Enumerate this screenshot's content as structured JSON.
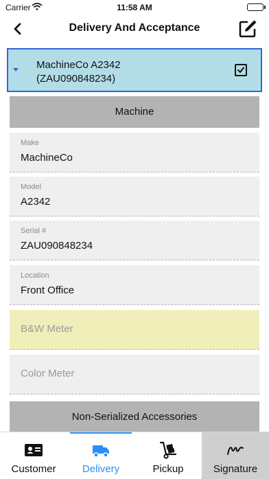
{
  "status": {
    "carrier": "Carrier",
    "time": "11:58 AM"
  },
  "nav": {
    "title": "Delivery And Acceptance",
    "back_icon": "chevron-left-icon",
    "edit_icon": "edit-icon"
  },
  "machine": {
    "title": "MachineCo A2342",
    "subtitle": "(ZAU090848234)",
    "checked": true
  },
  "sections": {
    "machine": "Machine",
    "accessories": "Non-Serialized Accessories"
  },
  "fields": {
    "make": {
      "label": "Make",
      "value": "MachineCo"
    },
    "model": {
      "label": "Model",
      "value": "A2342"
    },
    "serial": {
      "label": "Serial #",
      "value": "ZAU090848234"
    },
    "location": {
      "label": "Location",
      "value": "Front Office"
    },
    "bw_meter": {
      "placeholder": "B&W Meter"
    },
    "color_meter": {
      "placeholder": "Color Meter"
    }
  },
  "colors": {
    "accent": "#2b8ff4",
    "header_bg": "#b2dde6",
    "header_border": "#2e67d9",
    "highlight": "#f1efb9"
  },
  "tabs": [
    {
      "label": "Customer",
      "icon": "id-card-icon"
    },
    {
      "label": "Delivery",
      "icon": "delivery-truck-icon"
    },
    {
      "label": "Pickup",
      "icon": "hand-truck-icon"
    },
    {
      "label": "Signature",
      "icon": "signature-icon"
    }
  ]
}
